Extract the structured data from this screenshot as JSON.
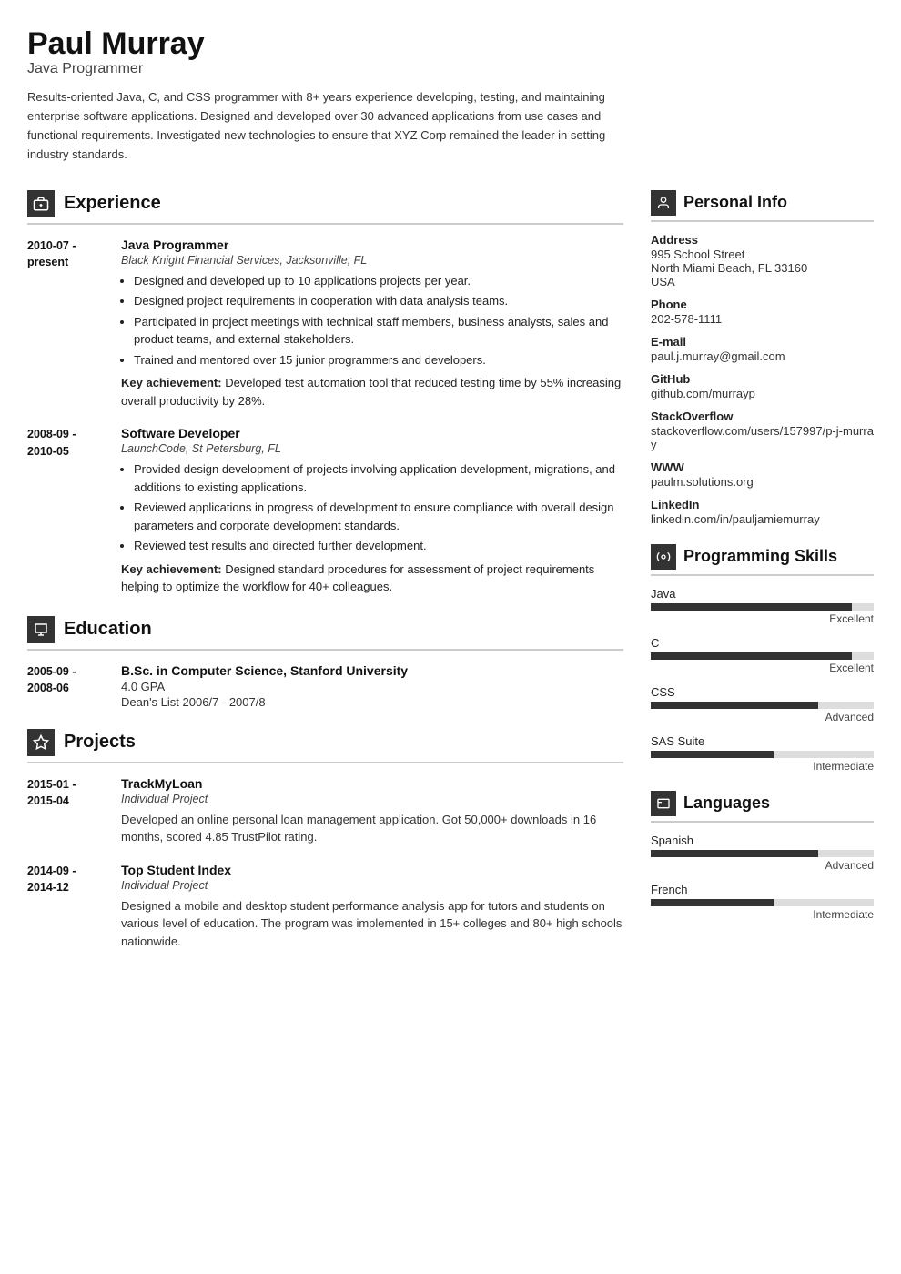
{
  "header": {
    "name": "Paul Murray",
    "title": "Java Programmer",
    "summary": "Results-oriented Java, C, and CSS programmer with 8+ years experience developing, testing, and maintaining enterprise software applications. Designed and developed over 30 advanced applications from use cases and functional requirements. Investigated new technologies to ensure that XYZ Corp remained the leader in setting industry standards."
  },
  "experience": {
    "section_title": "Experience",
    "entries": [
      {
        "date_start": "2010-07 -",
        "date_end": "present",
        "title": "Java Programmer",
        "subtitle": "Black Knight Financial Services, Jacksonville, FL",
        "bullets": [
          "Designed and developed up to 10 applications projects per year.",
          "Designed project requirements in cooperation with data analysis teams.",
          "Participated in project meetings with technical staff members, business analysts, sales and product teams, and external stakeholders.",
          "Trained and mentored over 15 junior programmers and developers."
        ],
        "achievement": "Key achievement: Developed test automation tool that reduced testing time by 55% increasing overall productivity by 28%."
      },
      {
        "date_start": "2008-09 -",
        "date_end": "2010-05",
        "title": "Software Developer",
        "subtitle": "LaunchCode, St Petersburg, FL",
        "bullets": [
          "Provided design development of projects involving application development, migrations, and additions to existing applications.",
          "Reviewed applications in progress of development to ensure compliance with overall design parameters and corporate development standards.",
          "Reviewed test results and directed further development."
        ],
        "achievement": "Key achievement: Designed standard procedures for assessment of project requirements helping to optimize the workflow for 40+ colleagues."
      }
    ]
  },
  "education": {
    "section_title": "Education",
    "entries": [
      {
        "date_start": "2005-09 -",
        "date_end": "2008-06",
        "title": "B.Sc. in Computer Science, Stanford University",
        "subtitle": "",
        "details": [
          "4.0 GPA",
          "Dean's List 2006/7 - 2007/8"
        ]
      }
    ]
  },
  "projects": {
    "section_title": "Projects",
    "entries": [
      {
        "date_start": "2015-01 -",
        "date_end": "2015-04",
        "title": "TrackMyLoan",
        "subtitle": "Individual Project",
        "description": "Developed an online personal loan management application. Got 50,000+ downloads in 16 months, scored 4.85 TrustPilot rating."
      },
      {
        "date_start": "2014-09 -",
        "date_end": "2014-12",
        "title": "Top Student Index",
        "subtitle": "Individual Project",
        "description": "Designed a mobile and desktop student performance analysis app for tutors and students on various level of education. The program was implemented in 15+ colleges and 80+ high schools nationwide."
      }
    ]
  },
  "personal_info": {
    "section_title": "Personal Info",
    "address_label": "Address",
    "address": [
      "995 School Street",
      "North Miami Beach, FL 33160",
      "USA"
    ],
    "phone_label": "Phone",
    "phone": "202-578-1111",
    "email_label": "E-mail",
    "email": "paul.j.murray@gmail.com",
    "github_label": "GitHub",
    "github": "github.com/murrayp",
    "stackoverflow_label": "StackOverflow",
    "stackoverflow": "stackoverflow.com/users/157997/p-j-murray",
    "www_label": "WWW",
    "www": "paulm.solutions.org",
    "linkedin_label": "LinkedIn",
    "linkedin": "linkedin.com/in/pauljamiemurray"
  },
  "programming_skills": {
    "section_title": "Programming Skills",
    "skills": [
      {
        "name": "Java",
        "level_label": "Excellent",
        "percent": 90
      },
      {
        "name": "C",
        "level_label": "Excellent",
        "percent": 90
      },
      {
        "name": "CSS",
        "level_label": "Advanced",
        "percent": 75
      },
      {
        "name": "SAS Suite",
        "level_label": "Intermediate",
        "percent": 55
      }
    ]
  },
  "languages": {
    "section_title": "Languages",
    "langs": [
      {
        "name": "Spanish",
        "level_label": "Advanced",
        "percent": 75
      },
      {
        "name": "French",
        "level_label": "Intermediate",
        "percent": 55
      }
    ]
  },
  "icons": {
    "experience": "🗂",
    "education": "🎓",
    "projects": "⭐",
    "personal_info": "👤",
    "programming_skills": "⚙",
    "languages": "🏳"
  }
}
